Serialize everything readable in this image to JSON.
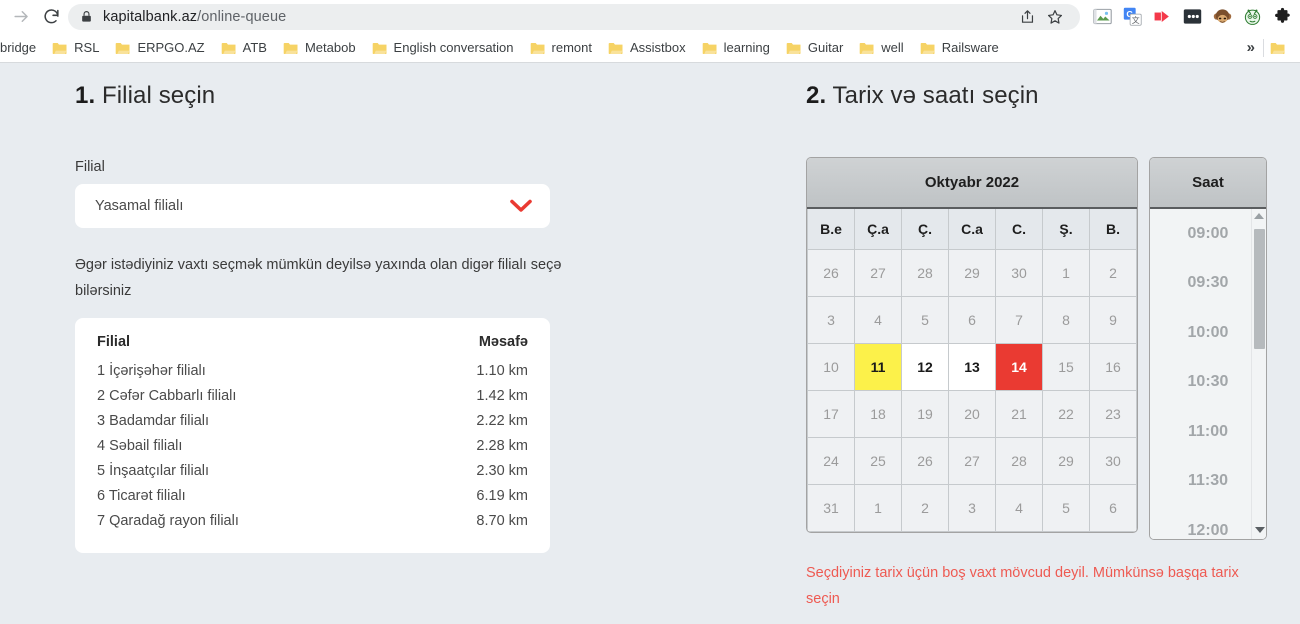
{
  "browser": {
    "nav": {
      "forward_icon": "arrow-right-icon",
      "reload_icon": "reload-icon"
    },
    "omnibox": {
      "lock_icon": "lock-icon",
      "url_domain": "kapitalbank.az",
      "url_path": "/online-queue",
      "share_icon": "share-icon",
      "bookmark_icon": "star-icon"
    },
    "extensions": [
      {
        "name": "image-capture-icon",
        "glyph": "🖼"
      },
      {
        "name": "google-translate-icon",
        "glyph": "G"
      },
      {
        "name": "media-player-icon",
        "glyph": "▶"
      },
      {
        "name": "password-manager-icon",
        "glyph": "•••"
      },
      {
        "name": "monkey-extension-icon",
        "glyph": "🙈"
      },
      {
        "name": "bot-extension-icon",
        "glyph": "🤖"
      },
      {
        "name": "extensions-puzzle-icon",
        "glyph": "🧩"
      }
    ],
    "bookmarks": [
      {
        "label": "bridge",
        "has_folder_icon": false
      },
      {
        "label": "RSL",
        "has_folder_icon": true
      },
      {
        "label": "ERPGO.AZ",
        "has_folder_icon": true
      },
      {
        "label": "ATB",
        "has_folder_icon": true
      },
      {
        "label": "Metabob",
        "has_folder_icon": true
      },
      {
        "label": "English conversation",
        "has_folder_icon": true
      },
      {
        "label": "remont",
        "has_folder_icon": true
      },
      {
        "label": "Assistbox",
        "has_folder_icon": true
      },
      {
        "label": "learning",
        "has_folder_icon": true
      },
      {
        "label": "Guitar",
        "has_folder_icon": true
      },
      {
        "label": "well",
        "has_folder_icon": true
      },
      {
        "label": "Railsware",
        "has_folder_icon": true
      }
    ],
    "bookmarks_overflow_label": "»"
  },
  "left": {
    "step_number": "1.",
    "title": " Filial seçin",
    "field_label": "Filial",
    "select_value": "Yasamal filialı",
    "chevron_icon": "chevron-down-icon",
    "chevron_color": "#ea3a32",
    "hint": "Əgər istədiyiniz vaxtı seçmək mümkün deyilsə yaxında olan digər filialı seçə bilərsiniz",
    "table": {
      "headers": [
        "Filial",
        "Məsafə"
      ],
      "rows": [
        {
          "name": "1 İçərişəhər filialı",
          "distance": "1.10 km"
        },
        {
          "name": "2 Cəfər Cabbarlı filialı",
          "distance": "1.42 km"
        },
        {
          "name": "3 Badamdar filialı",
          "distance": "2.22 km"
        },
        {
          "name": "4 Səbail filialı",
          "distance": "2.28 km"
        },
        {
          "name": "5 İnşaatçılar filialı",
          "distance": "2.30 km"
        },
        {
          "name": "6 Ticarət filialı",
          "distance": "6.19 km"
        },
        {
          "name": "7 Qaradağ rayon filialı",
          "distance": "8.70 km"
        }
      ]
    }
  },
  "right": {
    "step_number": "2.",
    "title": " Tarix və saatı seçin",
    "calendar": {
      "month_label": "Oktyabr 2022",
      "weekdays": [
        "B.e",
        "Ç.a",
        "Ç.",
        "C.a",
        "C.",
        "Ş.",
        "B."
      ],
      "weeks": [
        [
          {
            "d": "26",
            "state": "muted"
          },
          {
            "d": "27",
            "state": "muted"
          },
          {
            "d": "28",
            "state": "muted"
          },
          {
            "d": "29",
            "state": "muted"
          },
          {
            "d": "30",
            "state": "muted"
          },
          {
            "d": "1",
            "state": "muted"
          },
          {
            "d": "2",
            "state": "muted"
          }
        ],
        [
          {
            "d": "3",
            "state": "muted"
          },
          {
            "d": "4",
            "state": "muted"
          },
          {
            "d": "5",
            "state": "muted"
          },
          {
            "d": "6",
            "state": "muted"
          },
          {
            "d": "7",
            "state": "muted"
          },
          {
            "d": "8",
            "state": "muted"
          },
          {
            "d": "9",
            "state": "muted"
          }
        ],
        [
          {
            "d": "10",
            "state": "muted"
          },
          {
            "d": "11",
            "state": "today"
          },
          {
            "d": "12",
            "state": "avail"
          },
          {
            "d": "13",
            "state": "avail"
          },
          {
            "d": "14",
            "state": "selected"
          },
          {
            "d": "15",
            "state": "muted"
          },
          {
            "d": "16",
            "state": "muted"
          }
        ],
        [
          {
            "d": "17",
            "state": "muted"
          },
          {
            "d": "18",
            "state": "muted"
          },
          {
            "d": "19",
            "state": "muted"
          },
          {
            "d": "20",
            "state": "muted"
          },
          {
            "d": "21",
            "state": "muted"
          },
          {
            "d": "22",
            "state": "muted"
          },
          {
            "d": "23",
            "state": "muted"
          }
        ],
        [
          {
            "d": "24",
            "state": "muted"
          },
          {
            "d": "25",
            "state": "muted"
          },
          {
            "d": "26",
            "state": "muted"
          },
          {
            "d": "27",
            "state": "muted"
          },
          {
            "d": "28",
            "state": "muted"
          },
          {
            "d": "29",
            "state": "muted"
          },
          {
            "d": "30",
            "state": "muted"
          }
        ],
        [
          {
            "d": "31",
            "state": "muted"
          },
          {
            "d": "1",
            "state": "muted"
          },
          {
            "d": "2",
            "state": "muted"
          },
          {
            "d": "3",
            "state": "muted"
          },
          {
            "d": "4",
            "state": "muted"
          },
          {
            "d": "5",
            "state": "muted"
          },
          {
            "d": "6",
            "state": "muted"
          }
        ]
      ],
      "colors": {
        "today_bg": "#fcf14a",
        "selected_bg": "#ea3a32",
        "available_bg": "#ffffff",
        "muted_bg": "#eff1f3"
      }
    },
    "time": {
      "header": "Saat",
      "slots": [
        "09:00",
        "09:30",
        "10:00",
        "10:30",
        "11:00",
        "11:30",
        "12:00"
      ],
      "scroll_up_icon": "triangle-up-icon",
      "scroll_down_icon": "triangle-down-icon"
    },
    "warning": "Seçdiyiniz tarix üçün boş vaxt mövcud deyil. Mümkünsə başqa tarix seçin",
    "warning_color": "#ee5a52"
  }
}
